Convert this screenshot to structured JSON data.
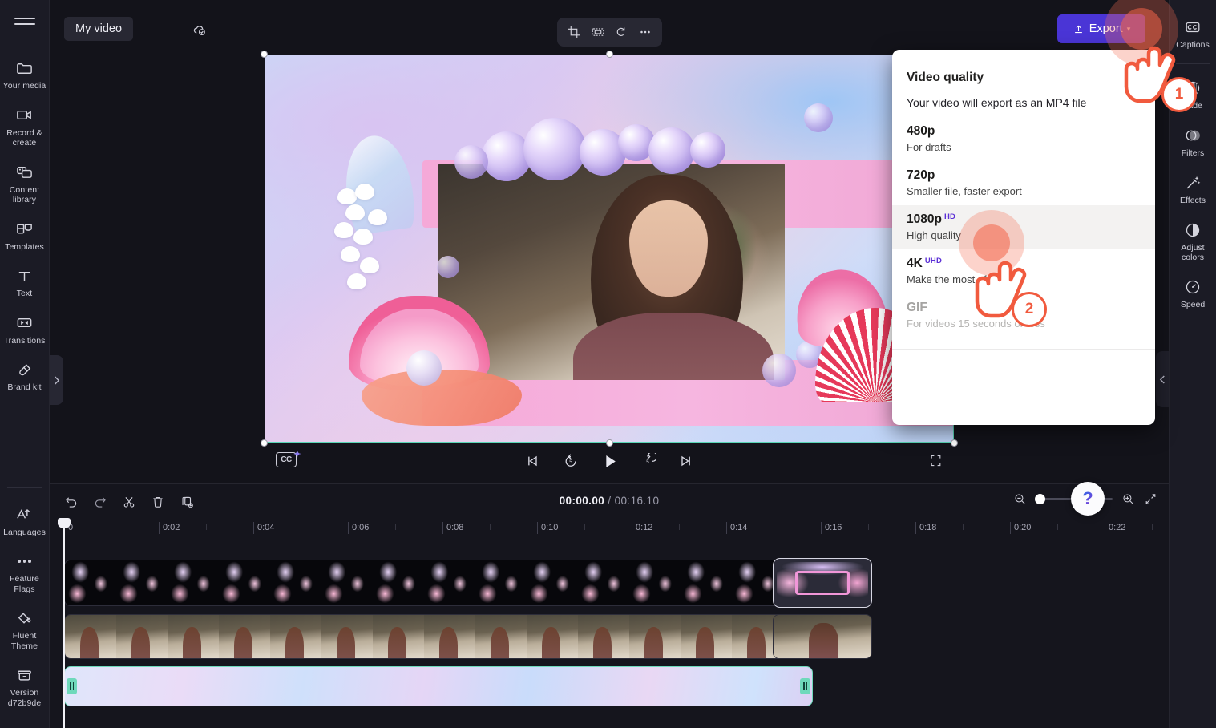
{
  "app": {
    "project_name": "My video",
    "saved_icon": "cloud-check-icon"
  },
  "left_sidebar": {
    "menu_icon": "hamburger-menu-icon",
    "items": [
      {
        "label": "Your media",
        "icon": "folder-icon"
      },
      {
        "label": "Record & create",
        "icon": "video-camera-icon"
      },
      {
        "label": "Content library",
        "icon": "content-library-icon"
      },
      {
        "label": "Templates",
        "icon": "templates-icon"
      },
      {
        "label": "Text",
        "icon": "text-icon"
      },
      {
        "label": "Transitions",
        "icon": "transitions-icon"
      },
      {
        "label": "Brand kit",
        "icon": "brand-kit-icon"
      }
    ],
    "bottom_items": [
      {
        "label": "Languages",
        "icon": "translate-icon"
      },
      {
        "label": "Feature Flags",
        "icon": "ellipsis-icon"
      },
      {
        "label": "Fluent Theme",
        "icon": "paint-bucket-icon"
      },
      {
        "label": "Version d72b9de",
        "icon": "archive-icon"
      }
    ],
    "expand_icon": "chevron-right-icon"
  },
  "preview_toolbar": {
    "items": [
      {
        "name": "crop-icon"
      },
      {
        "name": "fit-to-frame-icon"
      },
      {
        "name": "rotate-icon"
      },
      {
        "name": "more-options-icon"
      }
    ]
  },
  "export": {
    "label": "Export",
    "icon": "upload-icon",
    "caret": "▾",
    "accent_color": "#4a35d6"
  },
  "export_menu": {
    "title": "Video quality",
    "subtitle": "Your video will export as an MP4 file",
    "options": [
      {
        "name": "480p",
        "badge": "",
        "desc": "For drafts",
        "state": "normal"
      },
      {
        "name": "720p",
        "badge": "",
        "desc": "Smaller file, faster export",
        "state": "normal"
      },
      {
        "name": "1080p",
        "badge": "HD",
        "desc": "High quality",
        "state": "selected"
      },
      {
        "name": "4K",
        "badge": "UHD",
        "desc": "Make the most of",
        "state": "normal"
      },
      {
        "name": "GIF",
        "badge": "",
        "desc": "For videos 15 seconds or less",
        "state": "disabled"
      }
    ],
    "badge_color": "#5b2fd6"
  },
  "right_sidebar": {
    "items": [
      {
        "label": "Captions",
        "icon": "cc-icon"
      },
      {
        "label": "Fade",
        "icon": "fade-icon"
      },
      {
        "label": "Filters",
        "icon": "filters-icon"
      },
      {
        "label": "Effects",
        "icon": "effects-wand-icon"
      },
      {
        "label": "Adjust colors",
        "icon": "contrast-icon"
      },
      {
        "label": "Speed",
        "icon": "speedometer-icon"
      }
    ],
    "collapse_icon": "chevron-left-icon"
  },
  "player": {
    "cc_label": "CC",
    "buttons": [
      {
        "name": "skip-to-start-button",
        "icon": "skip-previous-icon"
      },
      {
        "name": "rewind-5-button",
        "icon": "rewind-5-icon",
        "label": "5"
      },
      {
        "name": "play-button",
        "icon": "play-icon"
      },
      {
        "name": "forward-5-button",
        "icon": "forward-5-icon",
        "label": "5"
      },
      {
        "name": "skip-to-end-button",
        "icon": "skip-next-icon"
      }
    ],
    "fullscreen_icon": "fullscreen-icon"
  },
  "help": {
    "icon": "question-mark-icon",
    "collapse_icon": "chevron-down-icon"
  },
  "timeline": {
    "tools": [
      {
        "name": "undo-button",
        "icon": "undo-icon"
      },
      {
        "name": "redo-button",
        "icon": "redo-icon"
      },
      {
        "name": "split-button",
        "icon": "scissors-icon"
      },
      {
        "name": "delete-button",
        "icon": "trash-icon"
      },
      {
        "name": "duplicate-button",
        "icon": "duplicate-icon"
      }
    ],
    "current_time": "00:00.00",
    "separator": "/",
    "total_time": "00:16.10",
    "zoom": {
      "out_icon": "zoom-out-icon",
      "in_icon": "zoom-in-icon",
      "fit_icon": "fit-timeline-icon",
      "value": 0
    },
    "ruler_labels": [
      "0",
      "0:02",
      "0:04",
      "0:06",
      "0:08",
      "0:10",
      "0:12",
      "0:14",
      "0:16",
      "0:18",
      "0:20",
      "0:22"
    ],
    "playhead_position": "0",
    "tracks": [
      {
        "name": "overlay-track",
        "type": "graphic"
      },
      {
        "name": "video-track",
        "type": "video"
      },
      {
        "name": "audio-track",
        "type": "background"
      }
    ]
  },
  "markers": [
    {
      "step": "1",
      "target": "export-button"
    },
    {
      "step": "2",
      "target": "1080p-option"
    }
  ]
}
